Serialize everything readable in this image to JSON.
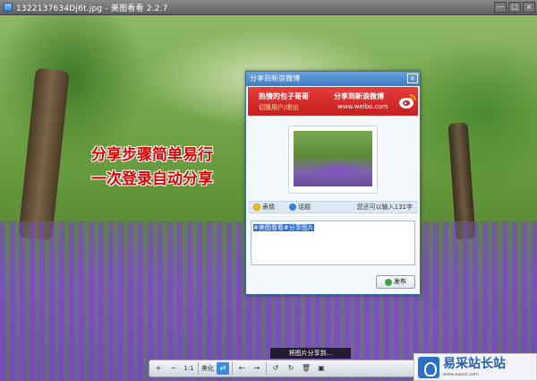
{
  "window": {
    "title": "1322137634Dj6t.jpg - 美图看看 2.2.7",
    "controls": [
      "—",
      "□",
      "×"
    ]
  },
  "overlay_text": {
    "line1": "分享步骤简单易行",
    "line2": "一次登录自动分享"
  },
  "share_dialog": {
    "title": "分享到新浪微博",
    "close": "×",
    "banner": {
      "username": "热情的包子哥哥",
      "switch_link": "切换用户/退出",
      "share_to": "分享到新浪微博",
      "url": "www.weibo.com"
    },
    "emoji_label": "表情",
    "topic_label": "话题",
    "counter": "您还可以输入131字",
    "message": "#美图看看#分享图片",
    "send_label": "发布"
  },
  "status_tip": "将图片分享到...",
  "viewer_toolbar": {
    "zoom_in": "+",
    "zoom_out": "−",
    "actual_size": "1:1",
    "beautify": "美化",
    "share": "⇄",
    "prev": "←",
    "next": "→",
    "rotate_left": "↺",
    "rotate_right": "↻",
    "delete": "🗑",
    "more": "▣"
  },
  "watermark": {
    "cn": "易采站长站",
    "en": "www.easck.com"
  },
  "colors": {
    "dialog_header": "#3d7cc4",
    "banner_red": "#c81e1e",
    "promo_red": "#e00000",
    "selection_blue": "#2d6fd1"
  }
}
